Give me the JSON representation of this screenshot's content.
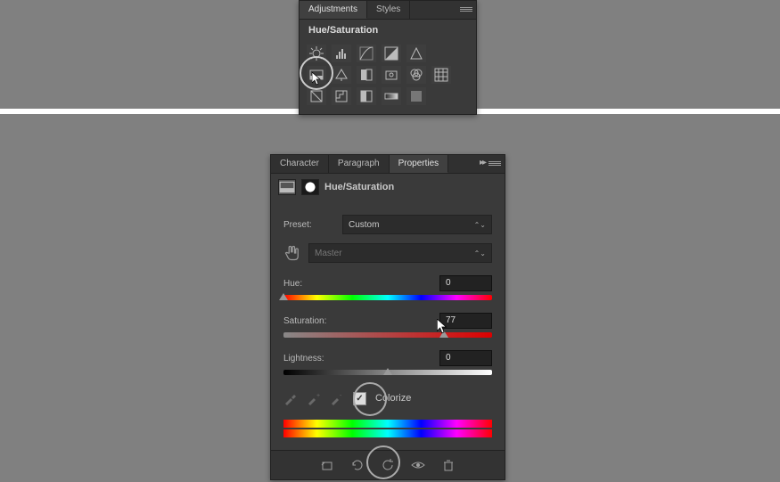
{
  "adjustments_panel": {
    "tabs": {
      "adjustments": "Adjustments",
      "styles": "Styles"
    },
    "title": "Hue/Saturation",
    "icons": {
      "row1": [
        "brightness",
        "levels",
        "curves",
        "exposure",
        "vibrance"
      ],
      "row2": [
        "hue-saturation",
        "color-balance",
        "bw",
        "photo-filter",
        "channel-mixer",
        "color-lookup"
      ],
      "row3": [
        "invert",
        "posterize",
        "threshold",
        "gradient-map",
        "selective-color"
      ]
    }
  },
  "properties_panel": {
    "tabs": {
      "character": "Character",
      "paragraph": "Paragraph",
      "properties": "Properties"
    },
    "title": "Hue/Saturation",
    "preset_label": "Preset:",
    "preset_value": "Custom",
    "channel_value": "Master",
    "sliders": {
      "hue": {
        "label": "Hue:",
        "value": "0"
      },
      "saturation": {
        "label": "Saturation:",
        "value": "77"
      },
      "lightness": {
        "label": "Lightness:",
        "value": "0"
      }
    },
    "colorize_label": "Colorize",
    "colorize_checked": true,
    "footer_icons": [
      "clip-to-layer",
      "view-previous",
      "reset",
      "toggle-visibility",
      "delete"
    ]
  }
}
